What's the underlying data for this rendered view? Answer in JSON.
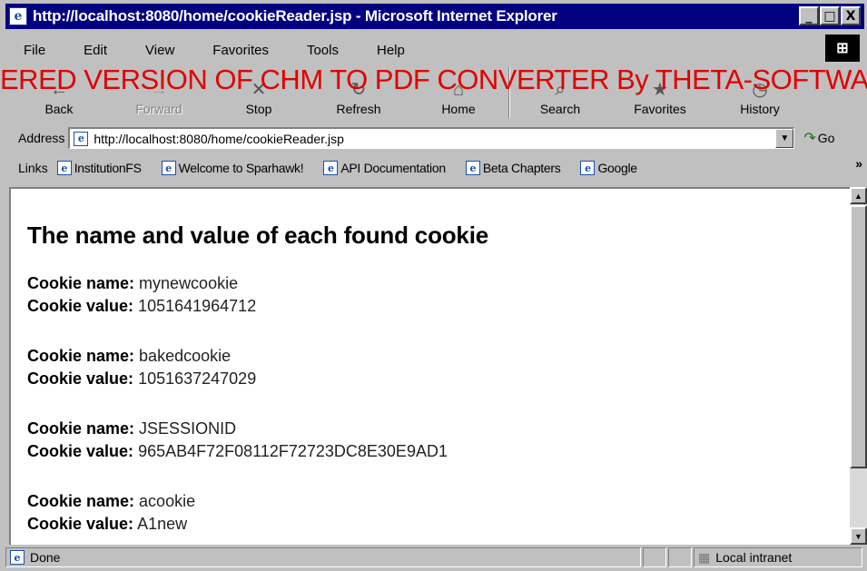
{
  "window": {
    "title": "http://localhost:8080/home/cookieReader.jsp - Microsoft Internet Explorer",
    "icon": "ie-page-icon",
    "buttons": [
      "_",
      "□",
      "X"
    ]
  },
  "menubar": {
    "items": [
      "File",
      "Edit",
      "View",
      "Favorites",
      "Tools",
      "Help"
    ]
  },
  "watermark": "ERED VERSION OF CHM TO PDF CONVERTER By THETA-SOFTWARE",
  "toolbar": {
    "buttons": [
      {
        "label": "Back",
        "icon": "back-arrow-icon",
        "enabled": true
      },
      {
        "label": "Forward",
        "icon": "forward-arrow-icon",
        "enabled": false
      },
      {
        "label": "Stop",
        "icon": "stop-icon",
        "enabled": true
      },
      {
        "label": "Refresh",
        "icon": "refresh-icon",
        "enabled": true
      },
      {
        "label": "Home",
        "icon": "home-icon",
        "enabled": true
      },
      {
        "label": "Search",
        "icon": "search-icon",
        "enabled": true
      },
      {
        "label": "Favorites",
        "icon": "favorites-icon",
        "enabled": true
      },
      {
        "label": "History",
        "icon": "history-icon",
        "enabled": true
      }
    ]
  },
  "address": {
    "label": "Address",
    "url": "http://localhost:8080/home/cookieReader.jsp",
    "go_label": "Go"
  },
  "links": {
    "label": "Links",
    "items": [
      "InstitutionFS",
      "Welcome to Sparhawk!",
      "API Documentation",
      "Beta Chapters",
      "Google"
    ]
  },
  "page": {
    "title": "The name and value of each found cookie",
    "name_label": "Cookie name:",
    "value_label": "Cookie value:",
    "cookies": [
      {
        "name": "mynewcookie",
        "value": "1051641964712"
      },
      {
        "name": "bakedcookie",
        "value": "1051637247029"
      },
      {
        "name": "JSESSIONID",
        "value": "965AB4F72F08112F72723DC8E30E9AD1"
      },
      {
        "name": "acookie",
        "value": "A1new"
      }
    ]
  },
  "status": {
    "text": "Done",
    "zone": "Local intranet"
  }
}
